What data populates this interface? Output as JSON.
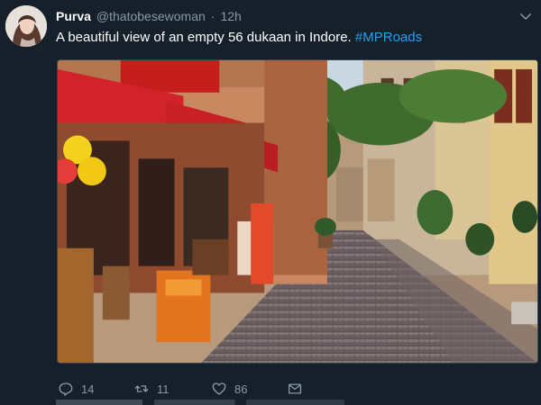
{
  "tweet": {
    "author_name": "Purva",
    "author_handle": "@thatobesewoman",
    "separator": "·",
    "timestamp": "12h",
    "text": "A beautiful view of an empty 56 dukaan in Indore.",
    "hashtag": "#MPRoads",
    "photo_alt": "Cobblestone street lined with shops with red awnings, flowers and greenery"
  },
  "actions": {
    "reply_count": "14",
    "retweet_count": "11",
    "like_count": "86"
  },
  "icons": {
    "reply": "reply-icon",
    "retweet": "retweet-icon",
    "like": "heart-icon",
    "dm": "envelope-icon",
    "menu": "chevron-down-icon"
  },
  "colors": {
    "background": "#15202b",
    "muted_text": "#8899a6",
    "link": "#1da1f2",
    "text": "#ffffff"
  }
}
